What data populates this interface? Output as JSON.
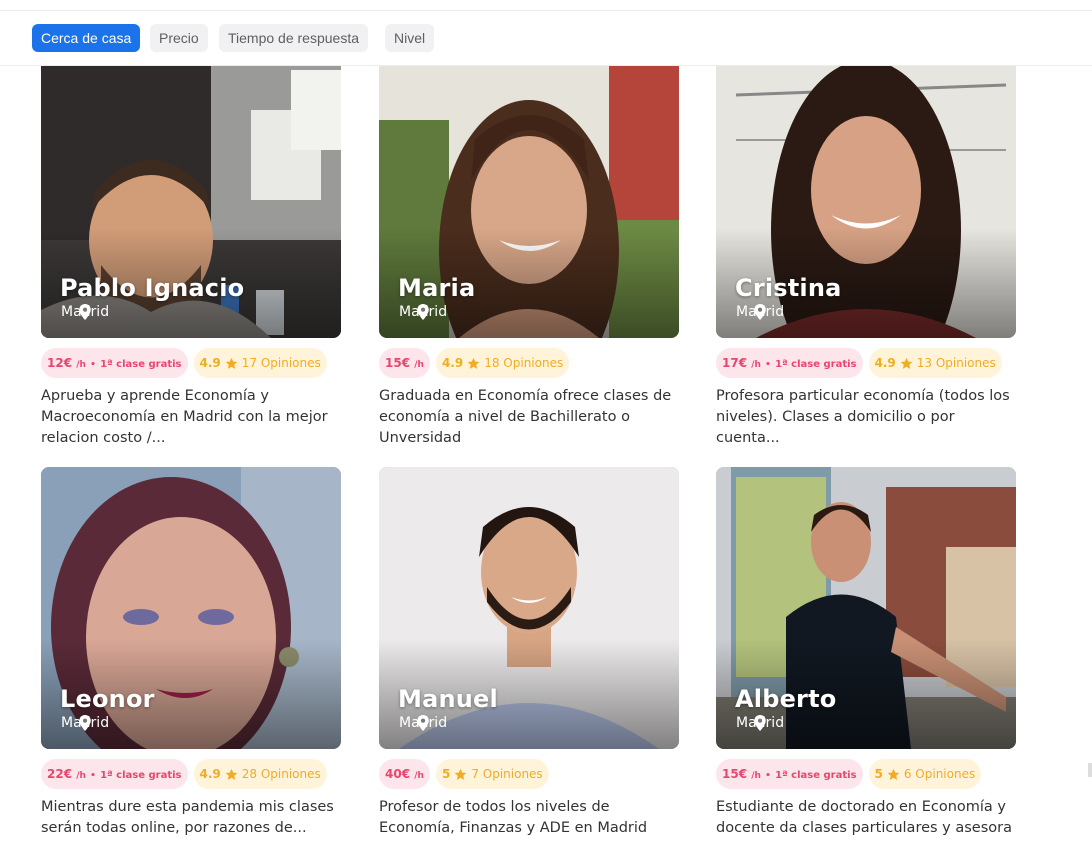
{
  "filters": [
    {
      "label": "Cerca de casa",
      "active": true
    },
    {
      "label": "Precio",
      "active": false
    },
    {
      "label": "Tiempo de respuesta",
      "active": false
    },
    {
      "label": "Nivel",
      "active": false
    }
  ],
  "tutors": [
    {
      "name": "Pablo Ignacio",
      "location": "Madrid",
      "price": "12€",
      "unit": "/h",
      "free_class": "1ª clase gratis",
      "rating": "4.9",
      "reviews": "17 Opiniones",
      "description": "Aprueba y aprende Economía y Macroeconomía en Madrid con la mejor relacion costo /..."
    },
    {
      "name": "Maria",
      "location": "Madrid",
      "price": "15€",
      "unit": "/h",
      "free_class": "",
      "rating": "4.9",
      "reviews": "18 Opiniones",
      "description": "Graduada en Economía ofrece clases de economía a nivel de Bachillerato o Unversidad"
    },
    {
      "name": "Cristina",
      "location": "Madrid",
      "price": "17€",
      "unit": "/h",
      "free_class": "1ª clase gratis",
      "rating": "4.9",
      "reviews": "13 Opiniones",
      "description": "Profesora particular economía (todos los niveles). Clases a domicilio o por cuenta..."
    },
    {
      "name": "Leonor",
      "location": "Madrid",
      "price": "22€",
      "unit": "/h",
      "free_class": "1ª clase gratis",
      "rating": "4.9",
      "reviews": "28 Opiniones",
      "description": "Mientras dure esta pandemia mis clases serán todas online, por razones de..."
    },
    {
      "name": "Manuel",
      "location": "Madrid",
      "price": "40€",
      "unit": "/h",
      "free_class": "",
      "rating": "5",
      "reviews": "7 Opiniones",
      "description": "Profesor de todos los niveles de Economía, Finanzas y ADE en Madrid"
    },
    {
      "name": "Alberto",
      "location": "Madrid",
      "price": "15€",
      "unit": "/h",
      "free_class": "1ª clase gratis",
      "rating": "5",
      "reviews": "6 Opiniones",
      "description": "Estudiante de doctorado en Economía y docente da clases particulares y asesora"
    }
  ],
  "colors": {
    "accent": "#1a73e8",
    "price_text": "#e8466e",
    "price_bg": "#fde5ec",
    "rating_text": "#f0ac24",
    "rating_bg": "#fff4da"
  },
  "icons": {
    "location": "location-pin-icon",
    "rating": "star-icon"
  }
}
